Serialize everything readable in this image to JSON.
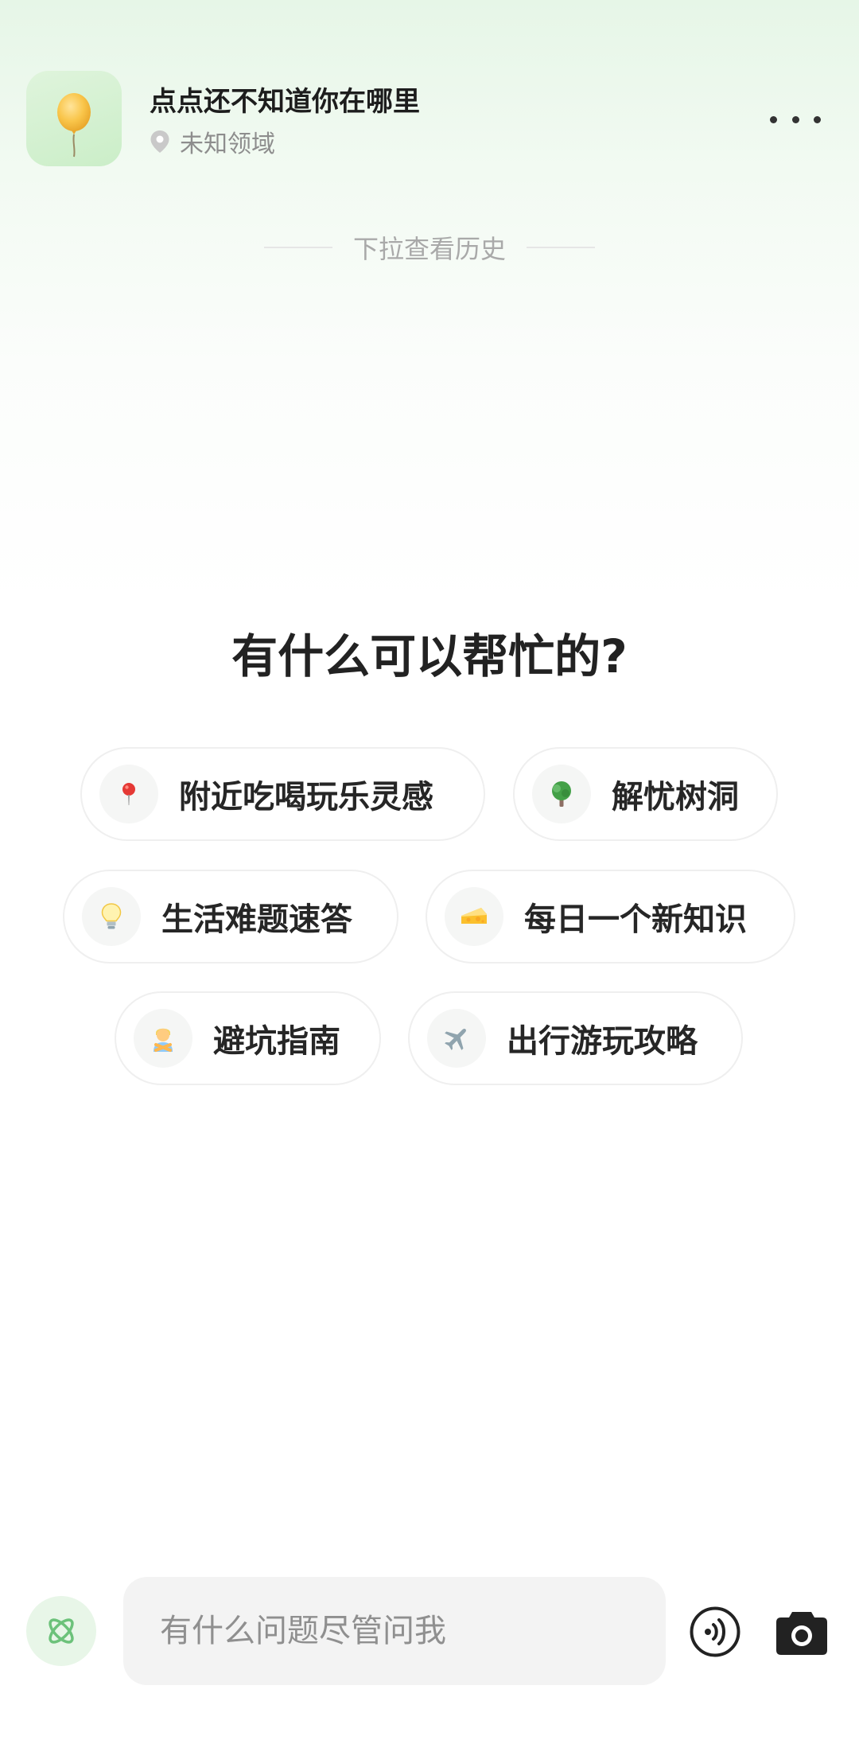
{
  "header": {
    "title": "点点还不知道你在哪里",
    "location": "未知领域",
    "logo_icon": "balloon-icon",
    "more_icon": "more-icon"
  },
  "pull_hint": "下拉查看历史",
  "main": {
    "title": "有什么可以帮忙的?"
  },
  "suggestions": [
    {
      "label": "附近吃喝玩乐灵感",
      "icon": "pin-icon"
    },
    {
      "label": "解忧树洞",
      "icon": "tree-icon"
    },
    {
      "label": "生活难题速答",
      "icon": "lightbulb-icon"
    },
    {
      "label": "每日一个新知识",
      "icon": "cheese-icon"
    },
    {
      "label": "避坑指南",
      "icon": "person-crossed-arms-icon"
    },
    {
      "label": "出行游玩攻略",
      "icon": "airplane-icon"
    }
  ],
  "input_bar": {
    "placeholder": "有什么问题尽管问我",
    "assistant_icon": "assistant-icon",
    "voice_icon": "voice-icon",
    "camera_icon": "camera-icon"
  },
  "colors": {
    "accent_green": "#6cc27a",
    "header_gradient_top": "#e6f6e7",
    "chip_border": "#efefef",
    "input_bg": "#f3f3f3"
  }
}
